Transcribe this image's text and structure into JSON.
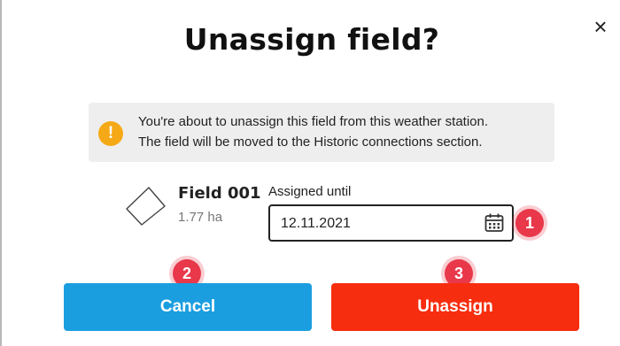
{
  "dialog": {
    "title": "Unassign field?",
    "close_glyph": "×"
  },
  "warning": {
    "icon": "warning-icon",
    "icon_glyph": "!",
    "color": "#f6a916",
    "line1": "You're about to unassign this field from this weather station.",
    "line2": "The field will be moved to the Historic connections section."
  },
  "field": {
    "name": "Field 001",
    "area": "1.77 ha"
  },
  "assigned_until": {
    "label": "Assigned until",
    "value": "12.11.2021",
    "icon": "calendar-icon"
  },
  "badges": {
    "one": "1",
    "two": "2",
    "three": "3",
    "color": "#e8384a"
  },
  "buttons": {
    "cancel_label": "Cancel",
    "cancel_color": "#1a9ee0",
    "unassign_label": "Unassign",
    "unassign_color": "#f72d0f"
  }
}
